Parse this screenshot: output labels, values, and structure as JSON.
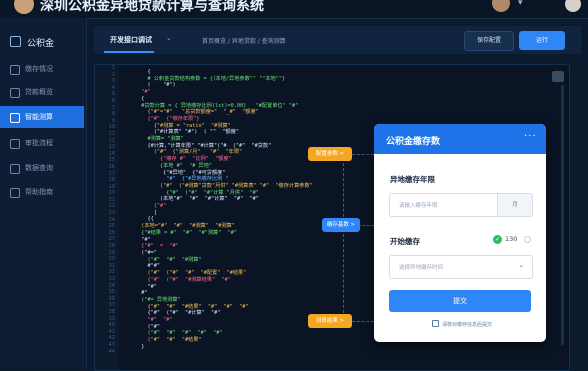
{
  "app": {
    "title": "深圳公积金异地贷款计算与查询系统"
  },
  "sidebar": {
    "brand": "公积金",
    "items": [
      {
        "label": "缴存情况",
        "active": false
      },
      {
        "label": "贷款概览",
        "active": false
      },
      {
        "label": "智能测算",
        "active": true
      },
      {
        "label": "审批流程",
        "active": false
      },
      {
        "label": "数据查询",
        "active": false
      },
      {
        "label": "帮助指南",
        "active": false
      }
    ]
  },
  "topbar": {
    "tab": "开发接口调试",
    "breadcrumb": "首页概览 / 异地贷款 / 查询测算",
    "btn_secondary": "保存配置",
    "btn_primary": "运行"
  },
  "editor": {
    "line_numbers": [
      "1",
      "2",
      "3",
      "4",
      "5",
      "6",
      "7",
      "8",
      "9",
      "10",
      "11",
      "12",
      "13",
      "14",
      "15",
      "16",
      "17",
      "18",
      "19",
      "20",
      "21",
      "22",
      "23",
      "24",
      "25",
      "26",
      "27",
      "28",
      "29",
      "30",
      "31",
      "32",
      "33",
      "34",
      "35",
      "36",
      "37",
      "38",
      "39",
      "40",
      "41",
      "42",
      "43",
      "44"
    ],
    "code_lines": [
      {
        "t": "    {",
        "c": "c-w"
      },
      {
        "t": "    # 公积金贷款结构参数 = {（本地/异地参数\"\" \"\"本地\"\"}",
        "c": "c-g"
      },
      {
        "t": "    (    \"#\")",
        "c": "c-w"
      },
      {
        "t": "  \"#\"",
        "c": "c-r"
      },
      {
        "t": "  {",
        "c": "c-w"
      },
      {
        "t": "  #贷款计算 = { 异地缴存比例(lst)=0.00}   \"#配置单位\" \"#\"",
        "c": "c-g"
      },
      {
        "t": "    {\"#\"=\"#\"   \"总贷款额度=\"  \"_#\"  \"额度\"",
        "c": "c-y"
      },
      {
        "t": "    {\"#\"  {\"缴存年限\"}",
        "c": "c-r"
      },
      {
        "t": "      {\"#测算 = \"ratio\"  \"#测算\"",
        "c": "c-y"
      },
      {
        "t": "      (\"#计算表\" \"#\")  ( \"\"  \"额度\"",
        "c": "c-w"
      },
      {
        "t": "    #测算= \"测算\"",
        "c": "c-g"
      },
      {
        "t": "    {#计算,\"计算年限\" \"#计算\"(\"#  (\"#\"  \"#贷款\"",
        "c": "c-w"
      },
      {
        "t": "      (\"#\"  {\"测算/月\"   \"#\"  \"年限\"",
        "c": "c-y"
      },
      {
        "t": "        {\"缴存 #\"  \"比例\"  \"额度\"",
        "c": "c-r"
      },
      {
        "t": "        {本地 #\"  \"# 异地\"",
        "c": "c-g"
      },
      {
        "t": "         {\"#异地\"  {\"#可贷额度\"",
        "c": "c-w"
      },
      {
        "t": "          \"#\"  {\"#异地缴存比例 \"",
        "c": "c-b"
      },
      {
        "t": "        (\"#\"  (\"#测算\"贷款\"月供\" \"#测算表\" \"#\"  \"缴存计算参数\"",
        "c": "c-y"
      },
      {
        "t": "          {\"#\"  (\"#\"  \"#\"计算 \"月供\"  \"#\"",
        "c": "c-g"
      },
      {
        "t": "        (本地\"#\"  \"#\"  \"#\"计算\"  \"#\"  \"#\"",
        "c": "c-w"
      },
      {
        "t": "      {\"#\"",
        "c": "c-r"
      },
      {
        "t": "      ]",
        "c": "c-w"
      },
      {
        "t": "    {{",
        "c": "c-w"
      },
      {
        "t": "  (本地=\"#\"  \"#\"  \"#测算\"  \"#测算\"",
        "c": "c-y"
      },
      {
        "t": "  {\"#结果 = #\"  \"#\"  \"#\"测算\"  \"#\"",
        "c": "c-g"
      },
      {
        "t": "  \"#\"",
        "c": "c-w"
      },
      {
        "t": "  {\"#\"  =  \"#\"",
        "c": "c-r"
      },
      {
        "t": "  (\"#=\"",
        "c": "c-w"
      },
      {
        "t": "    (\"#\"  \"#\"  \"#测算\"",
        "c": "c-g"
      },
      {
        "t": "    #\"#\"",
        "c": "c-w"
      },
      {
        "t": "    (\"#\"  (\"#\"  \"#\"  \"#配置\"  \"#结果\"",
        "c": "c-y"
      },
      {
        "t": "    {\"#\"  (\"#\"  \"#测算结果\"  \"#\"",
        "c": "c-r"
      },
      {
        "t": "    \"#\"",
        "c": "c-w"
      },
      {
        "t": "  #\"",
        "c": "c-w"
      },
      {
        "t": "  (\"#= 异地测算\"",
        "c": "c-g"
      },
      {
        "t": "    {\"#\"  \"#\"  \"#结果\"  \"#\"  \"#\"  \"#\"",
        "c": "c-y"
      },
      {
        "t": "    {\"#\"  (\"#\"  \"#计算\"  \"#\"",
        "c": "c-w"
      },
      {
        "t": "    \"#\"  \"#\"",
        "c": "c-r"
      },
      {
        "t": "    (\"#\"",
        "c": "c-w"
      },
      {
        "t": "    (\"#\"  \"#\"  \"#\"  \"#\"  \"#\"",
        "c": "c-g"
      },
      {
        "t": "    (\"#\"  \"#\"  \"#结果\"",
        "c": "c-y"
      },
      {
        "t": "  }",
        "c": "c-w"
      }
    ]
  },
  "callouts": {
    "c1": "配置参数 >",
    "c2": "缴存基数 >",
    "c3": "测算结果 >"
  },
  "panel": {
    "title": "公积金缴存数",
    "field1_label": "异地缴存年限",
    "field1_placeholder": "请输入缴存年限",
    "field1_unit": "月",
    "field2_label": "开始缴存",
    "count": "130",
    "field2_placeholder": "选择异地缴存时间",
    "submit": "提交",
    "footnote": "请核对缴存信息后提交"
  },
  "colors": {
    "accent": "#2f86f6",
    "callout_orange": "#f5a623",
    "success": "#2dbd5a"
  }
}
